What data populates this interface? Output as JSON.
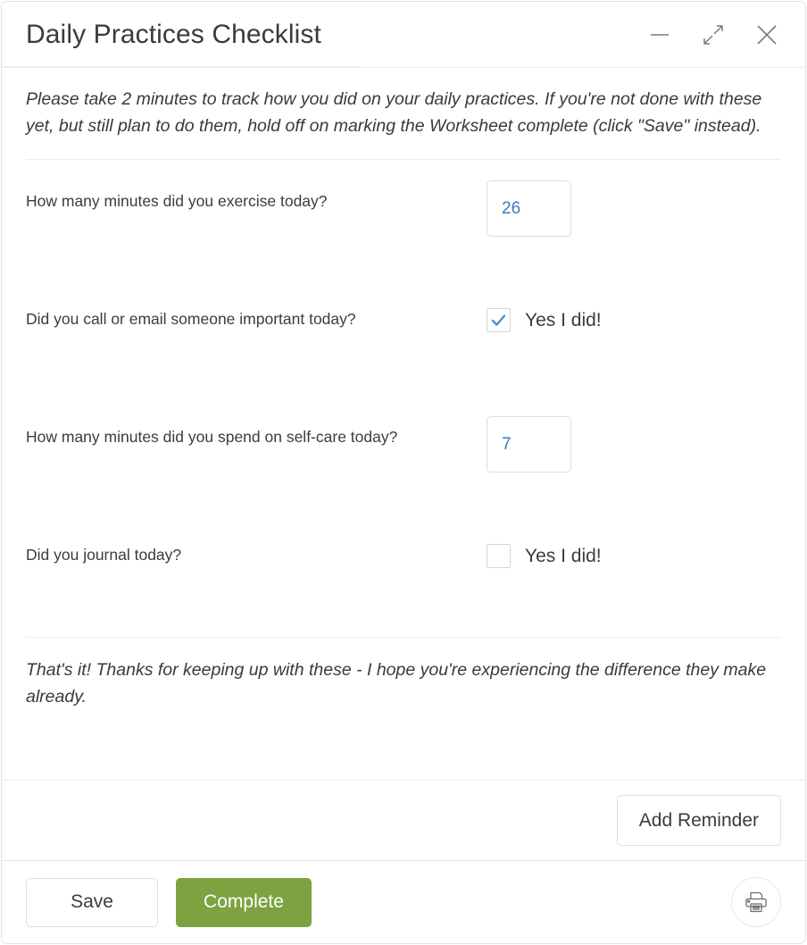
{
  "window": {
    "title": "Daily Practices Checklist",
    "controls": [
      {
        "name": "minimize-button",
        "glyph": "minimize"
      },
      {
        "name": "collapse-button",
        "glyph": "collapse-arrows"
      },
      {
        "name": "close-button",
        "glyph": "close-x"
      }
    ]
  },
  "colors": {
    "accent_blue": "#3a7cbe",
    "complete_green": "#7ca340",
    "border_gray": "#dedede",
    "text_dark": "#3c3c3c"
  },
  "intro_text": "Please take 2 minutes to track how you did on your daily practices. If you're not done with these yet, but still plan to do them, hold off on marking the Worksheet complete (click \"Save\" instead).",
  "questions": [
    {
      "label": "How many minutes did you exercise today?",
      "type": "number",
      "value": "26",
      "placeholder": ""
    },
    {
      "label": "Did you call or email someone important today?",
      "type": "checkbox",
      "checked": true,
      "check_label": "Yes I did!"
    },
    {
      "label": "How many minutes did you spend on self-care today?",
      "type": "number",
      "value": "7",
      "placeholder": ""
    },
    {
      "label": "Did you journal today?",
      "type": "checkbox",
      "checked": false,
      "check_label": "Yes I did!"
    }
  ],
  "outro_text": "That's it! Thanks for keeping up with these - I hope you're experiencing the difference they make already.",
  "reminder": {
    "add_reminder_label": "Add Reminder"
  },
  "actions": {
    "save_label": "Save",
    "complete_label": "Complete",
    "print_icon": "printer-icon"
  }
}
